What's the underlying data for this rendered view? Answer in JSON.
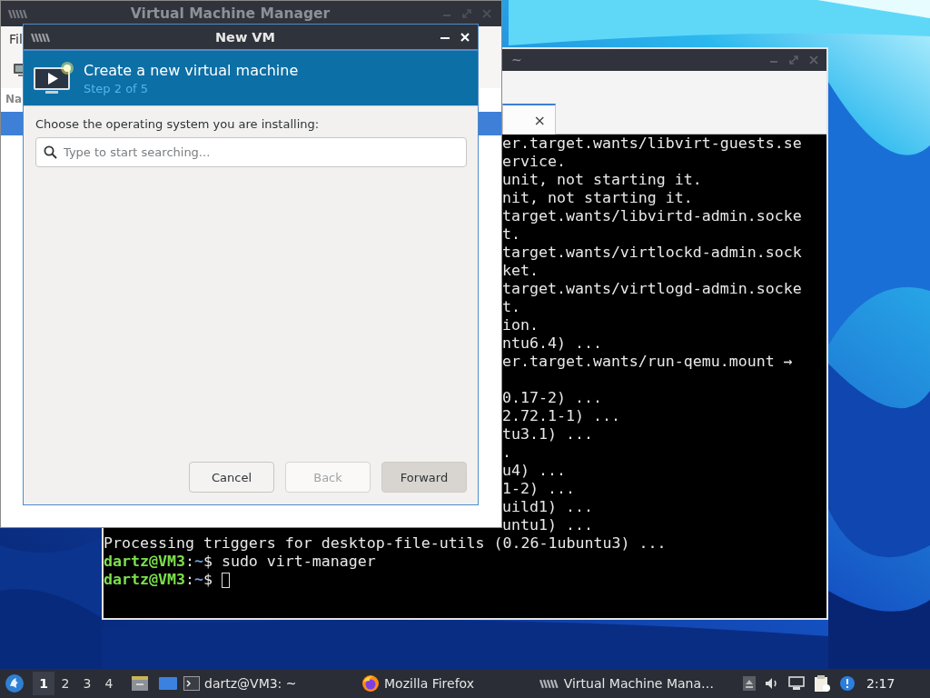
{
  "terminal_window": {
    "title": "~",
    "tabs": [
      {
        "selected": true,
        "close": "×"
      }
    ],
    "lines": [
      {
        "kind": "partial",
        "text": "er.target.wants/libvirt-guests.se"
      },
      {
        "kind": "partial",
        "text": "ervice."
      },
      {
        "kind": "partial",
        "text": "unit, not starting it."
      },
      {
        "kind": "partial",
        "text": "nit, not starting it."
      },
      {
        "kind": "partial",
        "text": "target.wants/libvirtd-admin.socke"
      },
      {
        "kind": "partial",
        "text": "t."
      },
      {
        "kind": "partial",
        "text": "target.wants/virtlockd-admin.sock"
      },
      {
        "kind": "partial",
        "text": "ket."
      },
      {
        "kind": "partial",
        "text": "target.wants/virtlogd-admin.socke"
      },
      {
        "kind": "partial",
        "text": "t."
      },
      {
        "kind": "partial",
        "text": "ion."
      },
      {
        "kind": "partial",
        "text": "ntu6.4) ..."
      },
      {
        "kind": "partial",
        "text": "er.target.wants/run-qemu.mount →"
      },
      {
        "kind": "blank"
      },
      {
        "kind": "partial",
        "text": "0.17-2) ..."
      },
      {
        "kind": "partial",
        "text": "2.72.1-1) ..."
      },
      {
        "kind": "partial",
        "text": "tu3.1) ..."
      },
      {
        "kind": "partial",
        "text": "."
      },
      {
        "kind": "partial",
        "text": "u4) ..."
      },
      {
        "kind": "partial",
        "text": "1-2) ..."
      },
      {
        "kind": "partial",
        "text": "uild1) ..."
      },
      {
        "kind": "partial",
        "text": "untu1) ..."
      },
      {
        "kind": "output",
        "text": "Processing triggers for desktop-file-utils (0.26-1ubuntu3) ..."
      },
      {
        "kind": "prompt",
        "host": "dartz@VM3",
        "sep": ":",
        "path": "~",
        "rest": "$ sudo virt-manager",
        "cursor": false
      },
      {
        "kind": "prompt",
        "host": "dartz@VM3",
        "sep": ":",
        "path": "~",
        "rest": "$ ",
        "cursor": true
      }
    ]
  },
  "vm_manager_window": {
    "title": "Virtual Machine Manager",
    "menu_item": "Fil",
    "column_header": "Na",
    "rows": [
      {
        "selected": true
      }
    ]
  },
  "new_vm_dialog": {
    "title": "New VM",
    "header": {
      "title": "Create a new virtual machine",
      "step": "Step 2 of 5"
    },
    "prompt": "Choose the operating system you are installing:",
    "search": {
      "placeholder": "Type to start searching..."
    },
    "buttons": [
      {
        "label": "Cancel",
        "disabled": false,
        "default": false
      },
      {
        "label": "Back",
        "disabled": true,
        "default": false
      },
      {
        "label": "Forward",
        "disabled": false,
        "default": true
      }
    ]
  },
  "taskbar": {
    "workspaces": [
      {
        "label": "1",
        "selected": true
      },
      {
        "label": "2",
        "selected": false
      },
      {
        "label": "3",
        "selected": false
      },
      {
        "label": "4",
        "selected": false
      }
    ],
    "tasks": [
      {
        "kind": "terminal",
        "label": "dartz@VM3: ~"
      },
      {
        "kind": "browser",
        "label": "Mozilla Firefox"
      },
      {
        "kind": "vm-manager",
        "label": "Virtual Machine Mana…"
      }
    ],
    "clock": "2:17"
  }
}
